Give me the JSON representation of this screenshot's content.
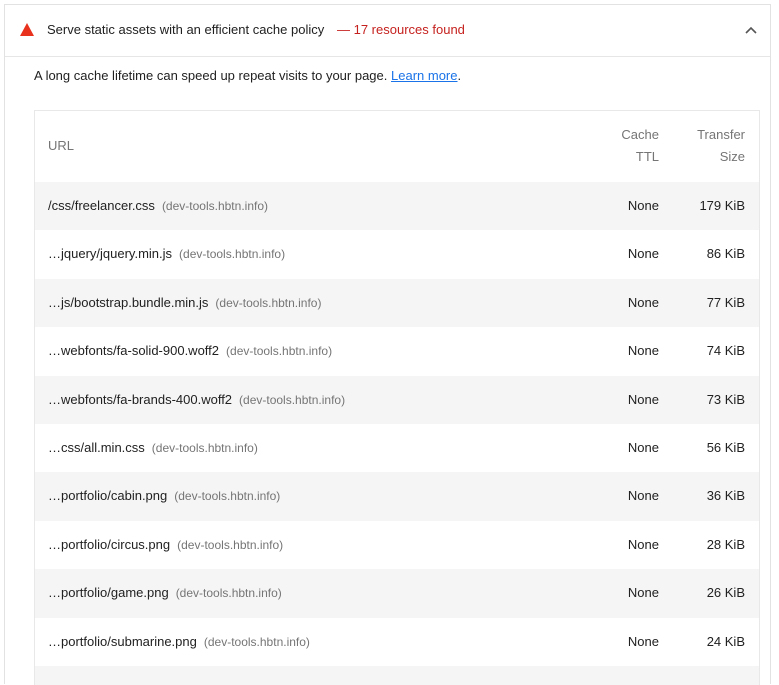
{
  "audit": {
    "title": "Serve static assets with an efficient cache policy",
    "display_value": "— 17 resources found",
    "status_color": "#e8321e",
    "description_text": "A long cache lifetime can speed up repeat visits to your page.",
    "learn_more": "Learn more",
    "description_end": "."
  },
  "table": {
    "headers": {
      "url": "URL",
      "cache_ttl_line1": "Cache",
      "cache_ttl_line2": "TTL",
      "transfer_size_line1": "Transfer",
      "transfer_size_line2": "Size"
    },
    "rows": [
      {
        "url": "/css/freelancer.css",
        "host": "(dev-tools.hbtn.info)",
        "ttl": "None",
        "size": "179 KiB"
      },
      {
        "url": "…jquery/jquery.min.js",
        "host": "(dev-tools.hbtn.info)",
        "ttl": "None",
        "size": "86 KiB"
      },
      {
        "url": "…js/bootstrap.bundle.min.js",
        "host": "(dev-tools.hbtn.info)",
        "ttl": "None",
        "size": "77 KiB"
      },
      {
        "url": "…webfonts/fa-solid-900.woff2",
        "host": "(dev-tools.hbtn.info)",
        "ttl": "None",
        "size": "74 KiB"
      },
      {
        "url": "…webfonts/fa-brands-400.woff2",
        "host": "(dev-tools.hbtn.info)",
        "ttl": "None",
        "size": "73 KiB"
      },
      {
        "url": "…css/all.min.css",
        "host": "(dev-tools.hbtn.info)",
        "ttl": "None",
        "size": "56 KiB"
      },
      {
        "url": "…portfolio/cabin.png",
        "host": "(dev-tools.hbtn.info)",
        "ttl": "None",
        "size": "36 KiB"
      },
      {
        "url": "…portfolio/circus.png",
        "host": "(dev-tools.hbtn.info)",
        "ttl": "None",
        "size": "28 KiB"
      },
      {
        "url": "…portfolio/game.png",
        "host": "(dev-tools.hbtn.info)",
        "ttl": "None",
        "size": "26 KiB"
      },
      {
        "url": "…portfolio/submarine.png",
        "host": "(dev-tools.hbtn.info)",
        "ttl": "None",
        "size": "24 KiB"
      }
    ]
  }
}
